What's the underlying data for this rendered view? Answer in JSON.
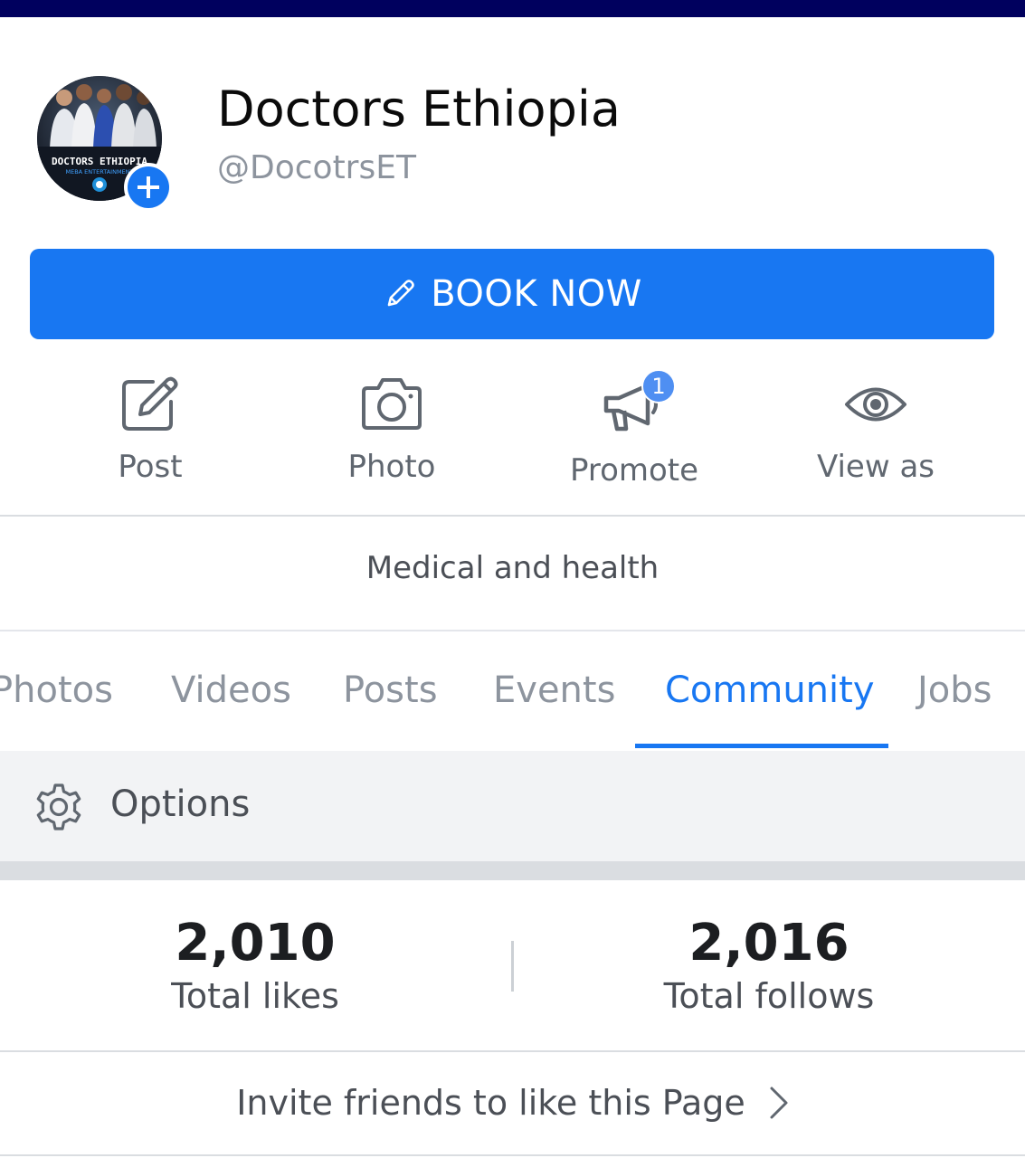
{
  "page": {
    "name": "Doctors Ethiopia",
    "handle": "@DocotrsET",
    "avatar_text": "DOCTORS ETHIOPIA",
    "avatar_subtext": "MEBA ENTERTAINMENT"
  },
  "cta": {
    "label": "BOOK NOW",
    "icon": "pencil-icon"
  },
  "actions": [
    {
      "label": "Post",
      "icon": "compose-icon"
    },
    {
      "label": "Photo",
      "icon": "camera-icon"
    },
    {
      "label": "Promote",
      "icon": "megaphone-icon",
      "badge": "1"
    },
    {
      "label": "View as",
      "icon": "eye-icon"
    }
  ],
  "category": "Medical and health",
  "tabs": [
    {
      "label": "Photos",
      "active": false
    },
    {
      "label": "Videos",
      "active": false
    },
    {
      "label": "Posts",
      "active": false
    },
    {
      "label": "Events",
      "active": false
    },
    {
      "label": "Community",
      "active": true
    },
    {
      "label": "Jobs",
      "active": false
    }
  ],
  "options": {
    "label": "Options",
    "icon": "gear-icon"
  },
  "stats": {
    "likes": {
      "value": "2,010",
      "label": "Total likes"
    },
    "follows": {
      "value": "2,016",
      "label": "Total follows"
    }
  },
  "invite": {
    "label": "Invite friends to like this Page",
    "icon": "chevron-right-icon"
  },
  "colors": {
    "accent": "#1877f2",
    "topbar": "#00005e",
    "muted": "#8d949e"
  }
}
